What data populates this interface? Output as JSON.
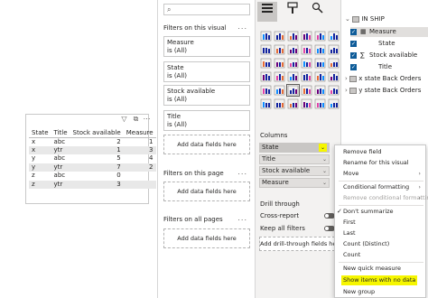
{
  "table_visual": {
    "headers": [
      "State",
      "Title",
      "Stock available",
      "Measure"
    ],
    "rows": [
      [
        "x",
        "abc",
        "2",
        "1"
      ],
      [
        "x",
        "ytr",
        "1",
        "3"
      ],
      [
        "y",
        "abc",
        "5",
        "4"
      ],
      [
        "y",
        "ytr",
        "7",
        "2"
      ],
      [
        "z",
        "abc",
        "0",
        ""
      ],
      [
        "z",
        "ytr",
        "3",
        ""
      ]
    ],
    "header_icons": [
      "filter-icon",
      "focus-mode-icon",
      "more-options-icon"
    ]
  },
  "filters_pane": {
    "filters_on_visual_title": "Filters on this visual",
    "cards": [
      {
        "name": "Measure",
        "value": "is (All)"
      },
      {
        "name": "State",
        "value": "is (All)"
      },
      {
        "name": "Stock available",
        "value": "is (All)"
      },
      {
        "name": "Title",
        "value": "is (All)"
      }
    ],
    "add_fields": "Add data fields here",
    "filters_on_page_title": "Filters on this page",
    "filters_on_all_pages_title": "Filters on all pages",
    "more": "..."
  },
  "viz_pane": {
    "columns_label": "Columns",
    "wells": [
      "State",
      "Title",
      "Stock available",
      "Measure"
    ],
    "drill_through_label": "Drill through",
    "cross_report_label": "Cross-report",
    "keep_all_filters_label": "Keep all filters",
    "add_drill_label": "Add drill-through fields here",
    "toggle_off": "Off"
  },
  "fields_pane": {
    "table_name": "IN SHIP",
    "fields": [
      "Measure",
      "State",
      "Stock available",
      "Title"
    ],
    "other_tables": [
      "x state Back Orders",
      "y state Back Orders"
    ]
  },
  "context_menu": {
    "items": [
      {
        "label": "Remove field",
        "disabled": false
      },
      {
        "label": "Rename for this visual",
        "disabled": false
      },
      {
        "label": "Move",
        "disabled": false,
        "submenu": true
      },
      {
        "label": "Conditional formatting",
        "disabled": false,
        "submenu": true
      },
      {
        "label": "Remove conditional formatting",
        "disabled": true,
        "submenu": true
      },
      {
        "label": "Don't summarize",
        "disabled": false,
        "checked": true
      },
      {
        "label": "First",
        "disabled": false
      },
      {
        "label": "Last",
        "disabled": false
      },
      {
        "label": "Count (Distinct)",
        "disabled": false
      },
      {
        "label": "Count",
        "disabled": false
      },
      {
        "label": "New quick measure",
        "disabled": false
      },
      {
        "label": "Show items with no data",
        "disabled": false,
        "highlighted": true
      },
      {
        "label": "New group",
        "disabled": false
      }
    ]
  },
  "colors": {
    "highlight": "#f6f600",
    "checkbox_blue": "#0e5c99",
    "pane_bg": "#f3f2f1"
  }
}
